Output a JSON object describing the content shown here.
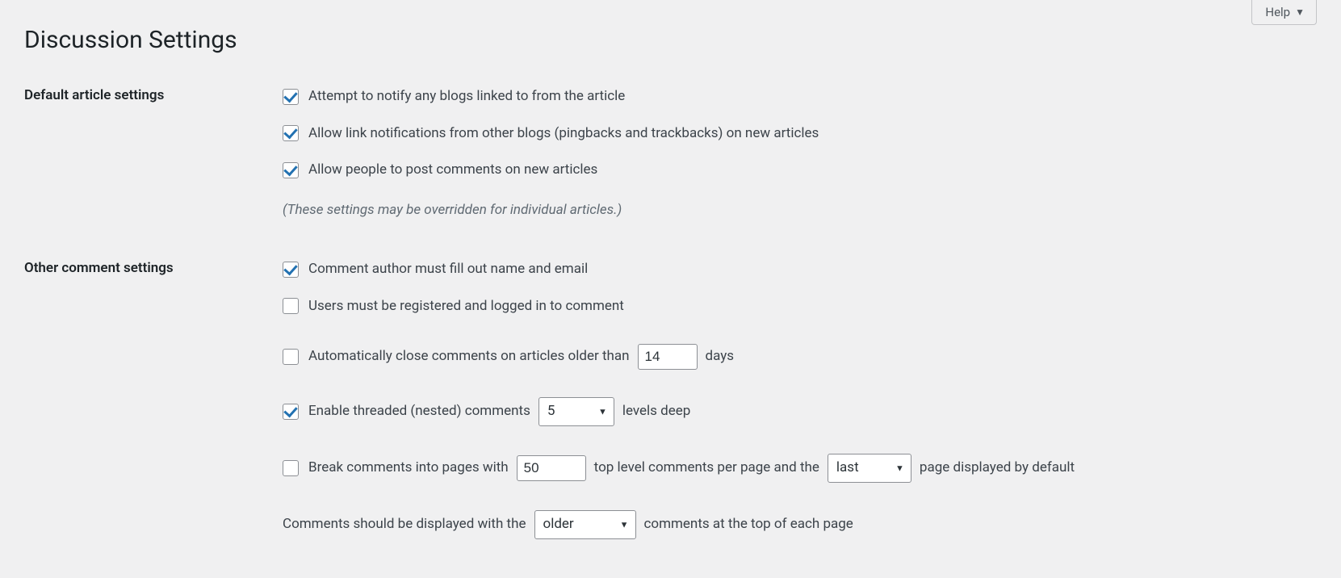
{
  "help_label": "Help",
  "page_title": "Discussion Settings",
  "sections": {
    "default_article": {
      "heading": "Default article settings",
      "notify_linked": "Attempt to notify any blogs linked to from the article",
      "allow_pingbacks": "Allow link notifications from other blogs (pingbacks and trackbacks) on new articles",
      "allow_comments": "Allow people to post comments on new articles",
      "override_hint": "(These settings may be overridden for individual articles.)"
    },
    "other_comment": {
      "heading": "Other comment settings",
      "require_name_email": "Comment author must fill out name and email",
      "require_registered": "Users must be registered and logged in to comment",
      "auto_close_prefix": "Automatically close comments on articles older than",
      "auto_close_days_value": "14",
      "auto_close_suffix": "days",
      "threaded_prefix": "Enable threaded (nested) comments",
      "threaded_levels_value": "5",
      "threaded_suffix": "levels deep",
      "paginate_prefix": "Break comments into pages with",
      "paginate_per_page_value": "50",
      "paginate_mid": "top level comments per page and the",
      "paginate_default_page_value": "last",
      "paginate_suffix": "page displayed by default",
      "order_prefix": "Comments should be displayed with the",
      "order_value": "older",
      "order_suffix": "comments at the top of each page"
    }
  }
}
